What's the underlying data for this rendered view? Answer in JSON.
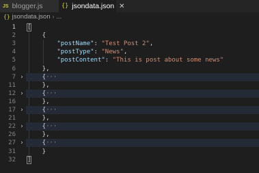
{
  "tabs": [
    {
      "icon": "JS",
      "label": "blogger.js",
      "active": false
    },
    {
      "icon": "{}",
      "label": "jsondata.json",
      "active": true,
      "close": "✕"
    }
  ],
  "breadcrumb": {
    "icon": "{}",
    "file": "jsondata.json",
    "separator": "›",
    "rest": "..."
  },
  "lines": [
    {
      "n": "1",
      "tokens": [
        {
          "c": "p",
          "t": "["
        }
      ]
    },
    {
      "n": "2",
      "tokens": [
        {
          "c": "p",
          "t": "    {"
        }
      ]
    },
    {
      "n": "3",
      "tokens": [
        {
          "c": "k",
          "t": "        \"postName\""
        },
        {
          "c": "p",
          "t": ": "
        },
        {
          "c": "s",
          "t": "\"Test Post 2\""
        },
        {
          "c": "p",
          "t": ","
        }
      ]
    },
    {
      "n": "4",
      "tokens": [
        {
          "c": "k",
          "t": "        \"postType\""
        },
        {
          "c": "p",
          "t": ": "
        },
        {
          "c": "s",
          "t": "\"News\""
        },
        {
          "c": "p",
          "t": ","
        }
      ]
    },
    {
      "n": "5",
      "tokens": [
        {
          "c": "k",
          "t": "        \"postContent\""
        },
        {
          "c": "p",
          "t": ": "
        },
        {
          "c": "s",
          "t": "\"This is post about some news\""
        }
      ]
    },
    {
      "n": "6",
      "tokens": [
        {
          "c": "p",
          "t": "    },"
        }
      ]
    },
    {
      "n": "7",
      "fold": "›",
      "folded": true,
      "tokens": [
        {
          "c": "p",
          "t": "    {"
        },
        {
          "c": "e",
          "t": "···"
        }
      ]
    },
    {
      "n": "11",
      "tokens": [
        {
          "c": "p",
          "t": "    },"
        }
      ]
    },
    {
      "n": "12",
      "fold": "›",
      "folded": true,
      "tokens": [
        {
          "c": "p",
          "t": "    {"
        },
        {
          "c": "e",
          "t": "···"
        }
      ]
    },
    {
      "n": "16",
      "tokens": [
        {
          "c": "p",
          "t": "    },"
        }
      ]
    },
    {
      "n": "17",
      "fold": "›",
      "folded": true,
      "tokens": [
        {
          "c": "p",
          "t": "    {"
        },
        {
          "c": "e",
          "t": "···"
        }
      ]
    },
    {
      "n": "21",
      "tokens": [
        {
          "c": "p",
          "t": "    },"
        }
      ]
    },
    {
      "n": "22",
      "fold": "›",
      "folded": true,
      "tokens": [
        {
          "c": "p",
          "t": "    {"
        },
        {
          "c": "e",
          "t": "···"
        }
      ]
    },
    {
      "n": "26",
      "tokens": [
        {
          "c": "p",
          "t": "    },"
        }
      ]
    },
    {
      "n": "27",
      "fold": "›",
      "folded": true,
      "tokens": [
        {
          "c": "p",
          "t": "    {"
        },
        {
          "c": "e",
          "t": "···"
        }
      ]
    },
    {
      "n": "31",
      "tokens": [
        {
          "c": "p",
          "t": "    }"
        }
      ]
    },
    {
      "n": "32",
      "tokens": [
        {
          "c": "p",
          "t": "]"
        }
      ]
    }
  ],
  "colors": {
    "background": "#1e1e1e",
    "key": "#9cdcfe",
    "string": "#ce9178",
    "punctuation": "#d4d4d4",
    "folded_highlight": "#242a36"
  }
}
